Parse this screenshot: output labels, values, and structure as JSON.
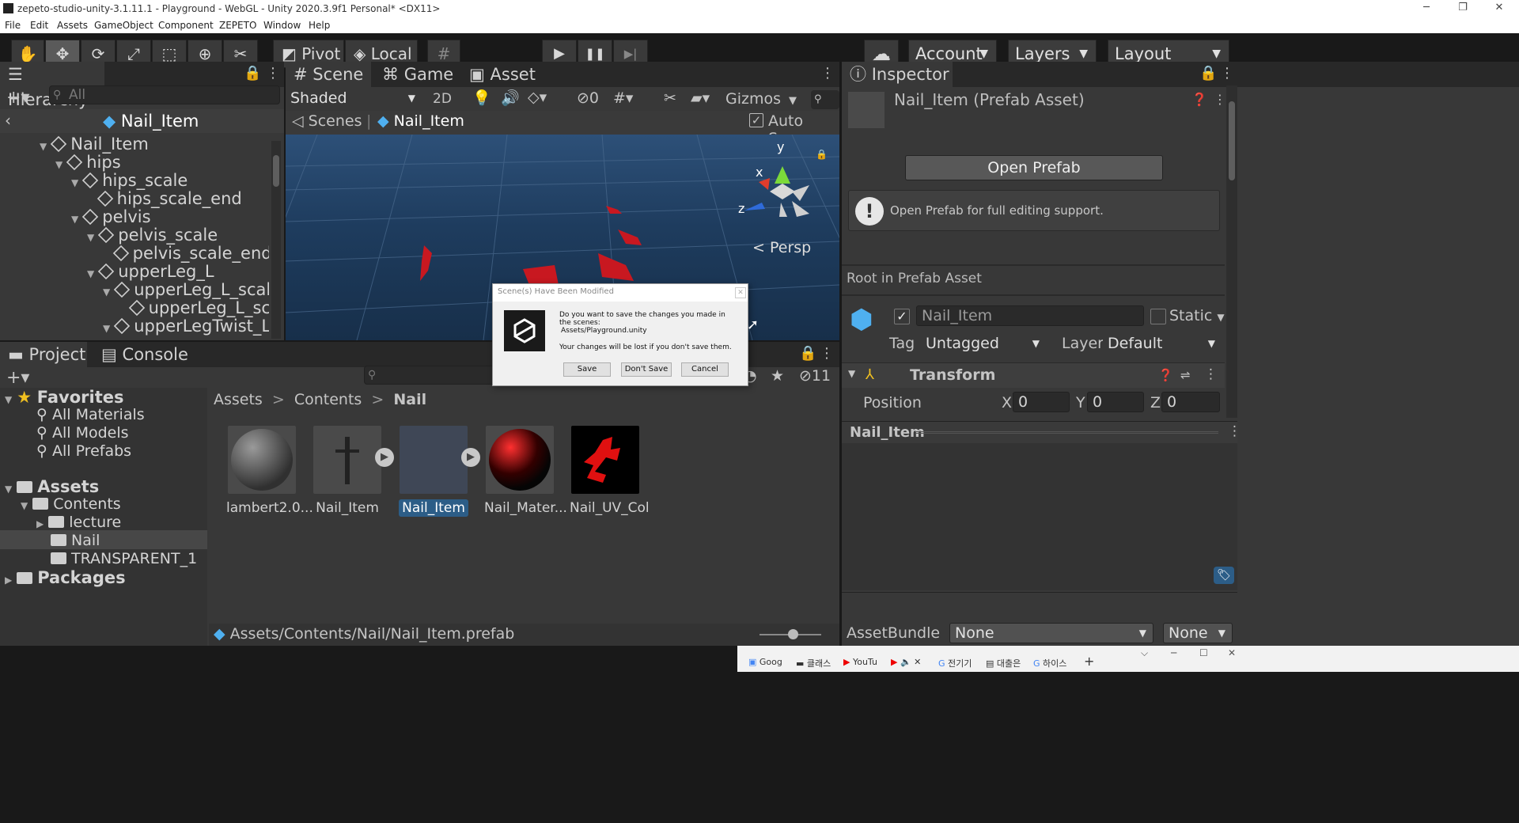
{
  "window": {
    "title": "zepeto-studio-unity-3.1.11.1 - Playground - WebGL - Unity 2020.3.9f1 Personal* <DX11>",
    "minimize": "─",
    "restore": "❐",
    "close": "✕"
  },
  "menu": [
    "File",
    "Edit",
    "Assets",
    "GameObject",
    "Component",
    "ZEPETO",
    "Window",
    "Help"
  ],
  "toolbar": {
    "pivot": "Pivot",
    "local": "Local",
    "account": "Account",
    "layers": "Layers",
    "layout": "Layout",
    "icons": {
      "hand": "✋",
      "move": "✥",
      "rotate": "⟳",
      "scale": "⤢",
      "rect": "⬚",
      "transform": "⊕",
      "custom": "✂",
      "grid": "#",
      "play": "▶",
      "pause": "❚❚",
      "step": "▶|",
      "cloud": "☁"
    }
  },
  "hierarchy": {
    "tab": "Hierarchy",
    "search_placeholder": "All",
    "header": "Nail_Item",
    "rows": [
      {
        "label": "Nail_Item",
        "depth": 0,
        "arrow": "▼"
      },
      {
        "label": "hips",
        "depth": 1,
        "arrow": "▼"
      },
      {
        "label": "hips_scale",
        "depth": 2,
        "arrow": "▼"
      },
      {
        "label": "hips_scale_end",
        "depth": 3,
        "arrow": ""
      },
      {
        "label": "pelvis",
        "depth": 2,
        "arrow": "▼"
      },
      {
        "label": "pelvis_scale",
        "depth": 3,
        "arrow": "▼"
      },
      {
        "label": "pelvis_scale_end",
        "depth": 4,
        "arrow": ""
      },
      {
        "label": "upperLeg_L",
        "depth": 3,
        "arrow": "▼"
      },
      {
        "label": "upperLeg_L_scale",
        "depth": 4,
        "arrow": "▼"
      },
      {
        "label": "upperLeg_L_scale_",
        "depth": 5,
        "arrow": ""
      },
      {
        "label": "upperLegTwist_L",
        "depth": 4,
        "arrow": "▼"
      }
    ]
  },
  "scene": {
    "tabs": [
      "Scene",
      "Game",
      "Asset Store"
    ],
    "shading": "Shaded",
    "mode_2d": "2D",
    "hidden_count": "0",
    "gizmos": "Gizmos",
    "breadcrumb_scenes": "Scenes",
    "breadcrumb_item": "Nail_Item",
    "auto_save": "Auto Save",
    "persp": "Persp",
    "axis_x": "x",
    "axis_y": "y",
    "axis_z": "z"
  },
  "dialog": {
    "title": "Scene(s) Have Been Modified",
    "line1": "Do you want to save the changes you made in the scenes:",
    "line2": "Assets/Playground.unity",
    "line3": "Your changes will be lost if you don't save them.",
    "save": "Save",
    "dont_save": "Don't Save",
    "cancel": "Cancel"
  },
  "project": {
    "tabs": [
      "Project",
      "Console"
    ],
    "hidden_count": "11",
    "favorites": "Favorites",
    "fav_items": [
      "All Materials",
      "All Models",
      "All Prefabs"
    ],
    "assets": "Assets",
    "contents": "Contents",
    "folders": [
      "lecture",
      "Nail",
      "TRANSPARENT_1"
    ],
    "packages": "Packages",
    "breadcrumb": [
      "Assets",
      "Contents",
      "Nail"
    ],
    "items": [
      "lambert2.0...",
      "Nail_Item",
      "Nail_Item",
      "Nail_Mater...",
      "Nail_UV_Col"
    ],
    "footer_path": "Assets/Contents/Nail/Nail_Item.prefab"
  },
  "inspector": {
    "tab": "Inspector",
    "title": "Nail_Item (Prefab Asset)",
    "open_prefab": "Open Prefab",
    "info": "Open Prefab for full editing support.",
    "root_label": "Root in Prefab Asset",
    "name": "Nail_Item",
    "static": "Static",
    "tag_label": "Tag",
    "tag_value": "Untagged",
    "layer_label": "Layer",
    "layer_value": "Default",
    "transform": "Transform",
    "position": "Position",
    "x_label": "X",
    "x": "0",
    "y_label": "Y",
    "y": "0",
    "z_label": "Z",
    "z": "0",
    "preview_name": "Nail_Item",
    "assetbundle_label": "AssetBundle",
    "assetbundle_value": "None",
    "variant_value": "None"
  },
  "taskbar": {
    "tabs": [
      "Goog",
      "클래스",
      "YouTu",
      "",
      "전기기",
      "대출은",
      "하이스"
    ],
    "plus": "+"
  }
}
